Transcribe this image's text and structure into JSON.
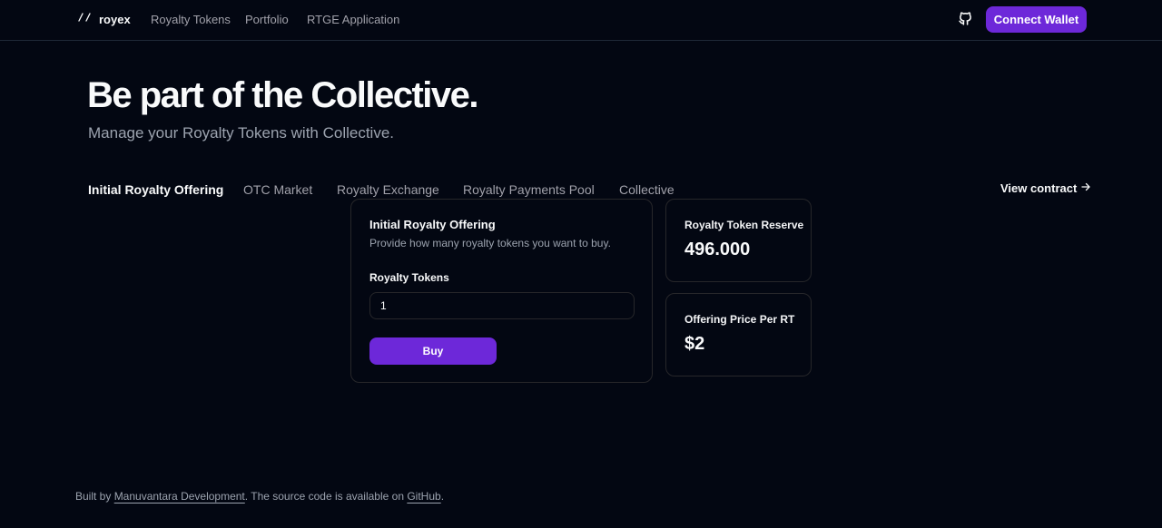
{
  "header": {
    "logo_text": "royex",
    "nav": [
      {
        "label": "Royalty Tokens"
      },
      {
        "label": "Portfolio"
      },
      {
        "label": "RTGE Application"
      }
    ],
    "connect_label": "Connect Wallet"
  },
  "hero": {
    "title": "Be part of the Collective.",
    "subtitle": "Manage your Royalty Tokens with Collective."
  },
  "tabs": [
    {
      "label": "Initial Royalty Offering",
      "active": true
    },
    {
      "label": "OTC Market"
    },
    {
      "label": "Royalty Exchange"
    },
    {
      "label": "Royalty Payments Pool"
    },
    {
      "label": "Collective"
    }
  ],
  "view_contract": "View contract",
  "buy_card": {
    "title": "Initial Royalty Offering",
    "description": "Provide how many royalty tokens you want to buy.",
    "field_label": "Royalty Tokens",
    "field_value": "1",
    "button_label": "Buy"
  },
  "stats": [
    {
      "label": "Royalty Token Reserve",
      "value": "496.000"
    },
    {
      "label": "Offering Price Per RT",
      "value": "$2"
    }
  ],
  "footer": {
    "prefix": "Built by ",
    "author": "Manuvantara Development",
    "middle": ". The source code is available on ",
    "repo": "GitHub",
    "suffix": "."
  },
  "colors": {
    "background": "#030712",
    "accent": "#6d28d9",
    "border": "#27272a",
    "muted_text": "#9ca3af"
  },
  "icons": {
    "logo": "slash-icon",
    "github": "github-icon",
    "arrow": "arrow-right-icon"
  }
}
